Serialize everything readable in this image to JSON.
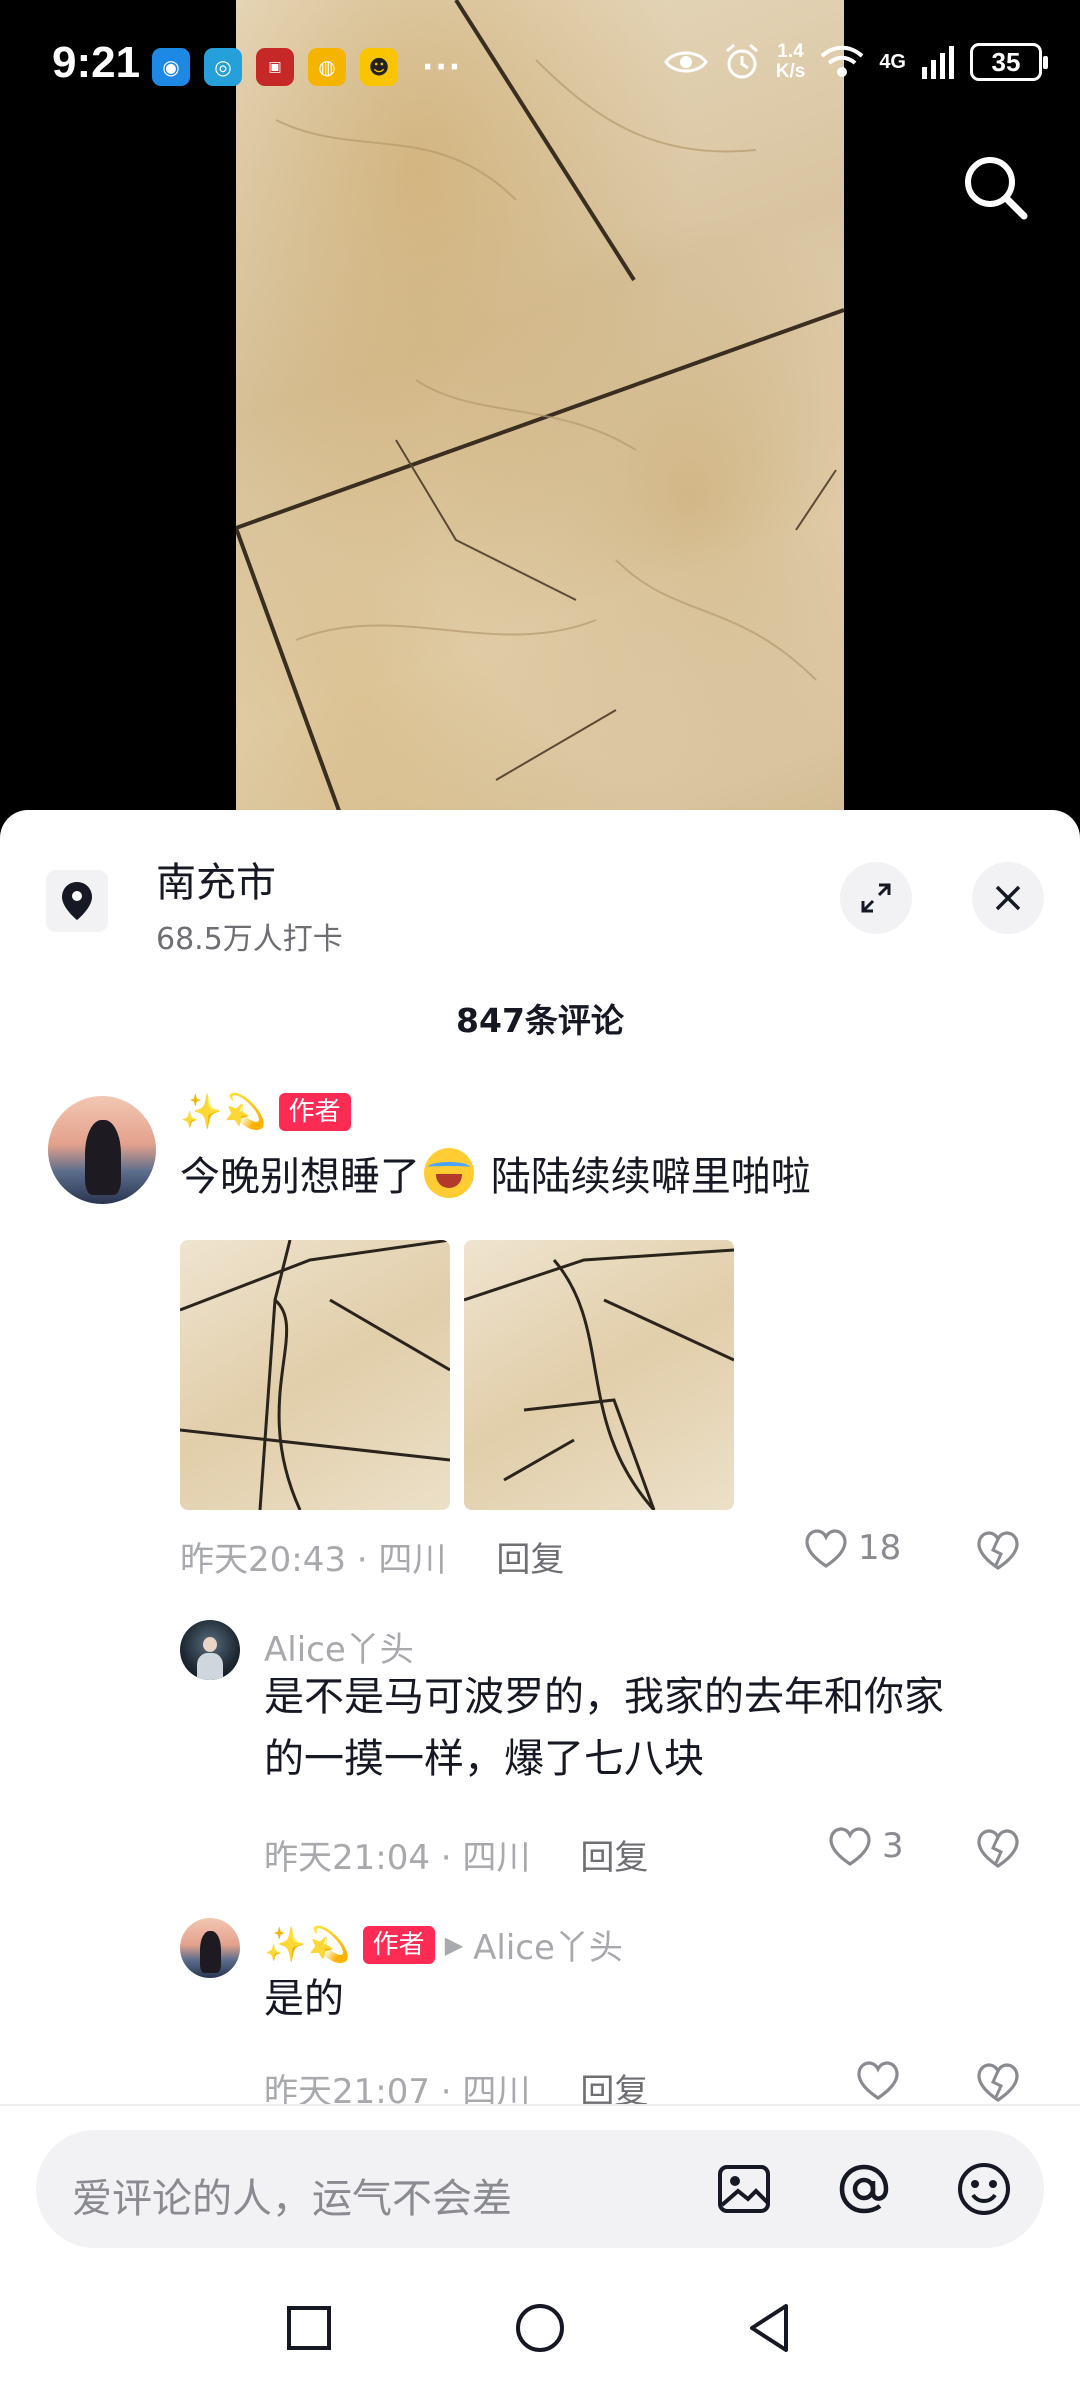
{
  "status_bar": {
    "time": "9:21",
    "more": "···",
    "speed_top": "1.4",
    "speed_bottom": "K/s",
    "network": "4G",
    "battery": "35"
  },
  "location": {
    "name": "南充市",
    "checkins": "68.5万人打卡"
  },
  "comment_count": "847条评论",
  "comments": [
    {
      "user": "✨💫",
      "tag": "作者",
      "text_before": "今晚别想睡了",
      "text_after": " 陆陆续续噼里啪啦",
      "time_loc": "昨天20:43 · 四川",
      "reply": "回复",
      "likes": "18"
    },
    {
      "user": "Alice丫头",
      "text_line1": "是不是马可波罗的，我家的去年和你家",
      "text_line2": "的一摸一样，爆了七八块",
      "time_loc": "昨天21:04 · 四川",
      "reply": "回复",
      "likes": "3"
    },
    {
      "user": "✨💫",
      "tag": "作者",
      "reply_arrow": "▶",
      "reply_to": "Alice丫头",
      "text": "是的",
      "time_loc": "昨天21:07 · 四川",
      "reply": "回复",
      "likes": ""
    }
  ],
  "input": {
    "placeholder": "爱评论的人，运气不会差"
  },
  "icons": {
    "search": "search-icon",
    "pin": "location-pin-icon",
    "expand": "expand-icon",
    "close": "close-icon",
    "heart": "heart-icon",
    "dislike": "broken-heart-icon",
    "image": "image-icon",
    "at": "at-icon",
    "emoji": "emoji-icon"
  },
  "colors": {
    "accent": "#fe2c55",
    "muted": "#a8a9ad"
  }
}
